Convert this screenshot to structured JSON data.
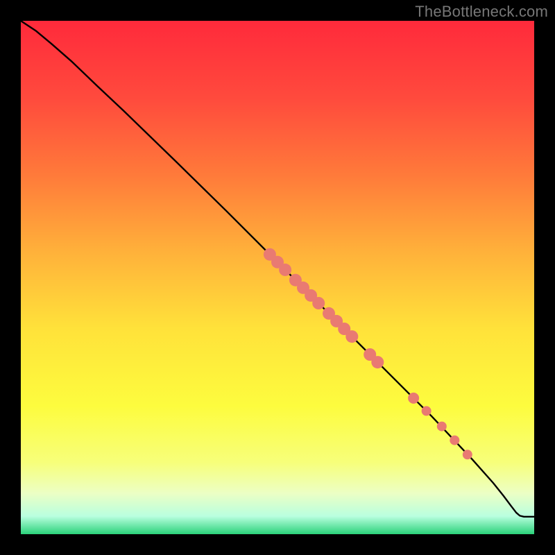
{
  "watermark": "TheBottleneck.com",
  "chart_data": {
    "type": "line",
    "title": "",
    "xlabel": "",
    "ylabel": "",
    "xlim": [
      0,
      100
    ],
    "ylim": [
      0,
      100
    ],
    "grid": false,
    "legend": false,
    "background_gradient_stops": [
      {
        "pct": 0,
        "color": "#ff2a3b"
      },
      {
        "pct": 15,
        "color": "#ff4a3d"
      },
      {
        "pct": 30,
        "color": "#ff7a3a"
      },
      {
        "pct": 45,
        "color": "#ffb13a"
      },
      {
        "pct": 60,
        "color": "#ffe23a"
      },
      {
        "pct": 75,
        "color": "#fdfc3e"
      },
      {
        "pct": 86,
        "color": "#f7ff7a"
      },
      {
        "pct": 92,
        "color": "#ecffc4"
      },
      {
        "pct": 96.5,
        "color": "#b9ffdf"
      },
      {
        "pct": 100,
        "color": "#2bd27a"
      }
    ],
    "curve": [
      {
        "x": 0,
        "y": 100
      },
      {
        "x": 3,
        "y": 98
      },
      {
        "x": 6,
        "y": 95.5
      },
      {
        "x": 10,
        "y": 92
      },
      {
        "x": 15,
        "y": 87.2
      },
      {
        "x": 20,
        "y": 82.5
      },
      {
        "x": 30,
        "y": 72.8
      },
      {
        "x": 40,
        "y": 63
      },
      {
        "x": 50,
        "y": 53
      },
      {
        "x": 60,
        "y": 43
      },
      {
        "x": 70,
        "y": 33
      },
      {
        "x": 80,
        "y": 23
      },
      {
        "x": 88,
        "y": 14.5
      },
      {
        "x": 92,
        "y": 10
      },
      {
        "x": 94,
        "y": 7.5
      },
      {
        "x": 95.5,
        "y": 5.5
      },
      {
        "x": 96.5,
        "y": 4.2
      },
      {
        "x": 97.2,
        "y": 3.6
      },
      {
        "x": 98,
        "y": 3.4
      },
      {
        "x": 100,
        "y": 3.4
      }
    ],
    "highlighted_points": [
      {
        "x": 48.5,
        "y": 54.5,
        "r": 9
      },
      {
        "x": 50,
        "y": 53,
        "r": 9
      },
      {
        "x": 51.5,
        "y": 51.5,
        "r": 9
      },
      {
        "x": 53.5,
        "y": 49.5,
        "r": 9
      },
      {
        "x": 55,
        "y": 48,
        "r": 9
      },
      {
        "x": 56.5,
        "y": 46.5,
        "r": 9
      },
      {
        "x": 58,
        "y": 45,
        "r": 9
      },
      {
        "x": 60,
        "y": 43,
        "r": 9
      },
      {
        "x": 61.5,
        "y": 41.5,
        "r": 9
      },
      {
        "x": 63,
        "y": 40,
        "r": 9
      },
      {
        "x": 64.5,
        "y": 38.5,
        "r": 9
      },
      {
        "x": 68,
        "y": 35,
        "r": 9
      },
      {
        "x": 69.5,
        "y": 33.5,
        "r": 9
      },
      {
        "x": 76.5,
        "y": 26.5,
        "r": 8
      },
      {
        "x": 79,
        "y": 24,
        "r": 7
      },
      {
        "x": 82,
        "y": 21,
        "r": 7
      },
      {
        "x": 84.5,
        "y": 18.3,
        "r": 7
      },
      {
        "x": 87,
        "y": 15.5,
        "r": 7
      }
    ],
    "point_color": "#e97a72",
    "curve_color": "#000000",
    "curve_width": 2.4
  }
}
